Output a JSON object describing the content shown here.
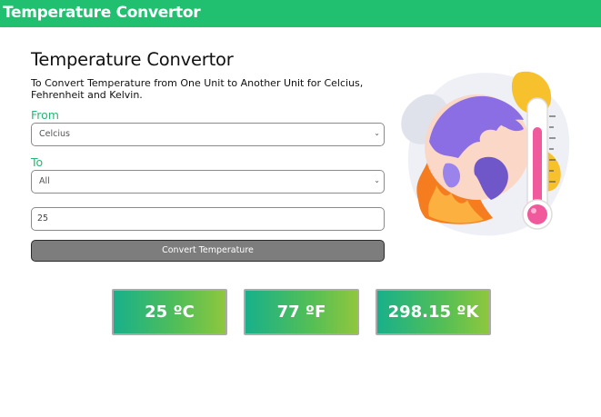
{
  "header": {
    "brand": "Temperature Convertor"
  },
  "main": {
    "title": "Temperature Convertor",
    "description": "To Convert Temperature from One Unit to Another Unit for Celcius, Fehrenheit and Kelvin."
  },
  "form": {
    "from_label": "From",
    "from_value": "Celcius",
    "to_label": "To",
    "to_value": "All",
    "temperature_value": "25",
    "convert_label": "Convert Temperature"
  },
  "results": {
    "celsius": "25 ºC",
    "fahrenheit": "77 ºF",
    "kelvin": "298.15 ºK"
  },
  "colors": {
    "accent": "#20c070",
    "label_green": "#2bb673",
    "button_gray": "#7d7d7d"
  },
  "icons": {
    "select_arrow": "chevron-down-icon",
    "illustration": "globe-thermometer-fire-illustration"
  }
}
